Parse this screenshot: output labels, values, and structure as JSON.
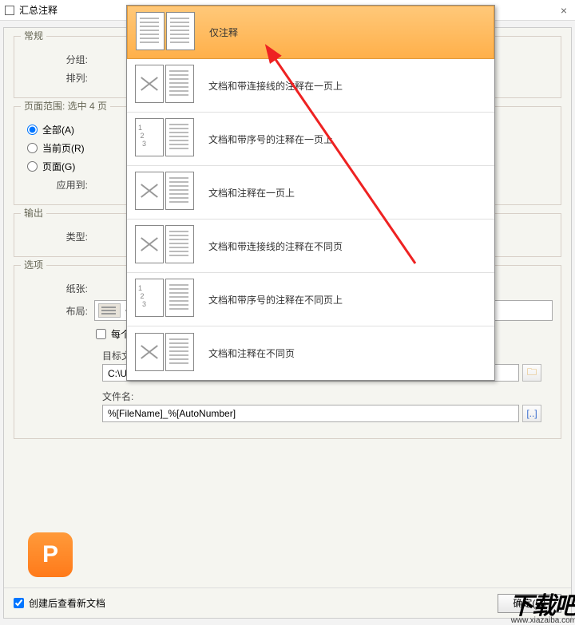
{
  "window": {
    "title": "汇总注释",
    "close": "×"
  },
  "sections": {
    "general": "常规",
    "group_lbl": "分组:",
    "sort_lbl": "排列:",
    "page_range": "页面范围: 选中 4 页",
    "radio_all": "全部(A)",
    "radio_current": "当前页(R)",
    "radio_pages": "页面(G)",
    "apply_to": "应用到:",
    "output": "输出",
    "type_lbl": "类型:",
    "options": "选项",
    "paper_lbl": "纸张:",
    "layout_lbl": "布局:",
    "layout_value": "仅注释",
    "chk_separate": "每个组放在单独的页面上",
    "folder_lbl": "目标文件夹:",
    "folder_value": "C:\\Users\\baiyanjun\\Desktop\\新建文件夹",
    "filename_lbl": "文件名:",
    "filename_value": "%[FileName]_%[AutoNumber]"
  },
  "dropdown": {
    "items": [
      {
        "label": "仅注释",
        "selected": true,
        "kind": "stack"
      },
      {
        "label": "文档和带连接线的注释在一页上",
        "selected": false,
        "kind": "x-lines"
      },
      {
        "label": "文档和带序号的注释在一页上",
        "selected": false,
        "kind": "num-lines"
      },
      {
        "label": "文档和注释在一页上",
        "selected": false,
        "kind": "x-lines-single"
      },
      {
        "label": "文档和带连接线的注释在不同页",
        "selected": false,
        "kind": "x-lines"
      },
      {
        "label": "文档和带序号的注释在不同页上",
        "selected": false,
        "kind": "num-lines"
      },
      {
        "label": "文档和注释在不同页",
        "selected": false,
        "kind": "x-lines-single"
      }
    ]
  },
  "bottom": {
    "check_after_create": "创建后查看新文档",
    "ok": "确定(O)"
  },
  "watermark": {
    "main": "下载吧",
    "sub": "www.xiazaiba.com"
  }
}
